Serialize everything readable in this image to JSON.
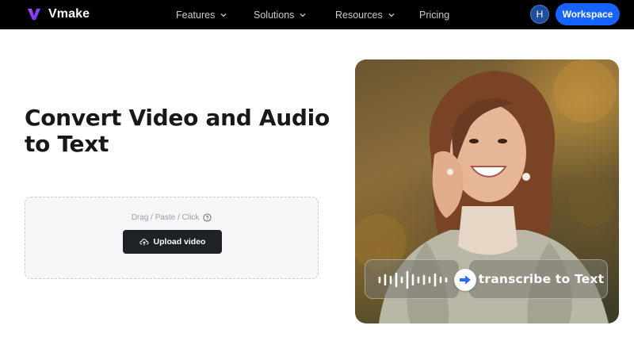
{
  "brand": {
    "name": "Vmake",
    "logo_color": "#8b3dff"
  },
  "nav": {
    "items": [
      {
        "label": "Features",
        "has_dropdown": true
      },
      {
        "label": "Solutions",
        "has_dropdown": true
      },
      {
        "label": "Resources",
        "has_dropdown": true
      },
      {
        "label": "Pricing",
        "has_dropdown": false
      }
    ],
    "avatar_initial": "H",
    "workspace_label": "Workspace",
    "accent": "#1664ff"
  },
  "hero": {
    "title": "Convert Video and Audio to Text",
    "upload": {
      "hint": "Drag / Paste / Click",
      "button_label": "Upload video",
      "icons": [
        "help-icon",
        "cloud-upload-icon"
      ]
    },
    "image": {
      "overlay_label": "transcribe to Text",
      "icons": [
        "waveform-icon",
        "arrow-right-icon"
      ]
    }
  }
}
